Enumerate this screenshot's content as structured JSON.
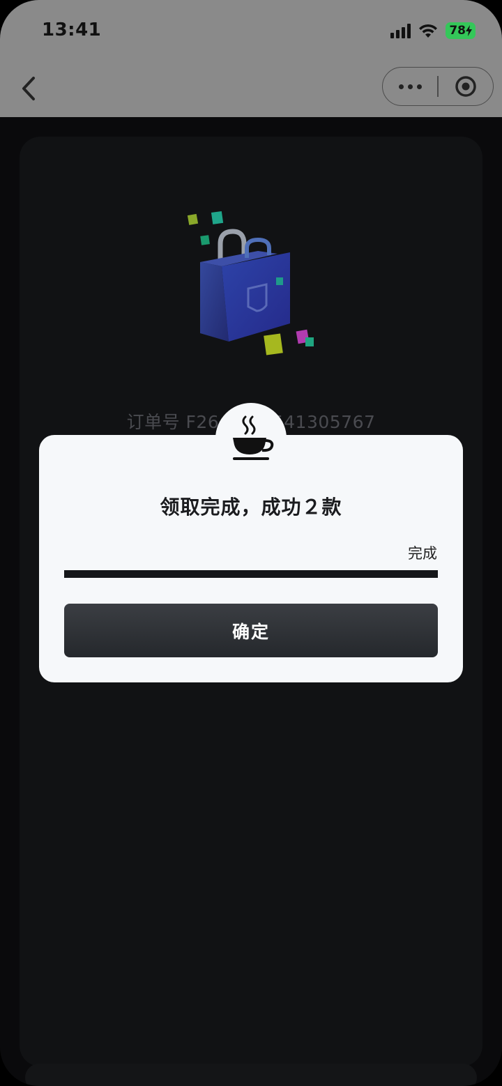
{
  "status_bar": {
    "time": "13:41",
    "battery": "78"
  },
  "nav": {
    "more_icon": "more-dots-icon",
    "close_icon": "record-circle-icon",
    "back_icon": "chevron-left-icon"
  },
  "background": {
    "order_text": "订单号 F26　　　541305767"
  },
  "dialog": {
    "title": "领取完成，成功２款",
    "progress_label": "完成",
    "progress_value": 1.0,
    "confirm_label": "确定",
    "badge_icon": "coffee-cup-icon"
  },
  "colors": {
    "dialog_bg": "#f6f8fa",
    "button_bg": "#2d3035",
    "progress_fill": "#15171a",
    "header_dim": "#8a8a8a",
    "battery_green": "#34c759"
  }
}
